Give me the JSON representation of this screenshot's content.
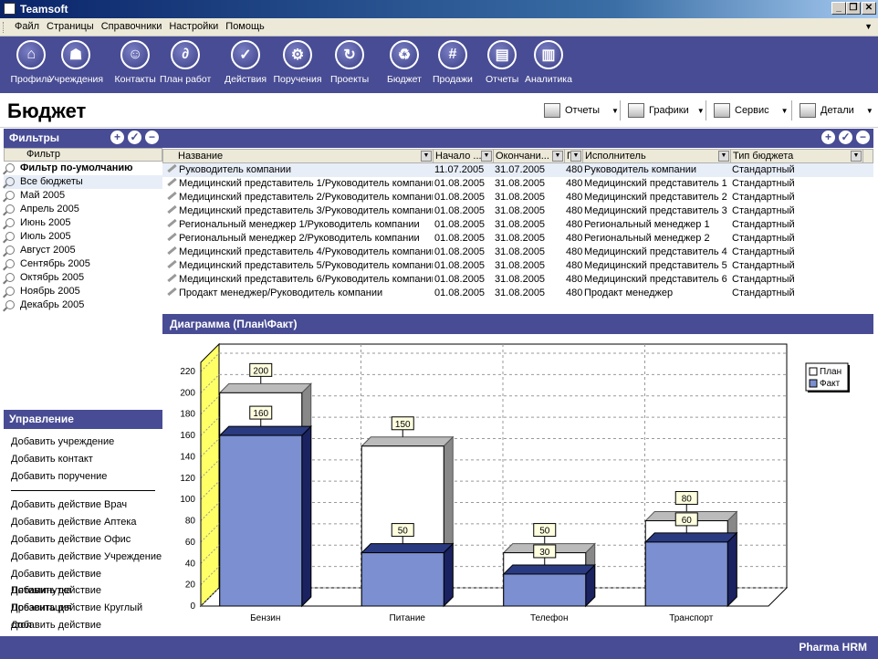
{
  "window": {
    "title": "Teamsoft"
  },
  "menu": [
    "Файл",
    "Страницы",
    "Справочники",
    "Настройки",
    "Помощь"
  ],
  "nav": [
    {
      "label": "Профиль",
      "icon": "house-icon",
      "glyph": "⌂"
    },
    {
      "label": "Учреждения",
      "icon": "people-icon",
      "glyph": "☗"
    },
    {
      "label": "Контакты",
      "icon": "person-icon",
      "glyph": "☺"
    },
    {
      "label": "План работ",
      "icon": "paperclip-icon",
      "glyph": "∂"
    },
    {
      "label": "Действия",
      "icon": "checkmark-icon",
      "glyph": "✓"
    },
    {
      "label": "Поручения",
      "icon": "gears-icon",
      "glyph": "⚙"
    },
    {
      "label": "Проекты",
      "icon": "arrow-icon",
      "glyph": "↻"
    },
    {
      "label": "Бюджет",
      "icon": "recycle-icon",
      "glyph": "♻"
    },
    {
      "label": "Продажи",
      "icon": "hash-icon",
      "glyph": "#"
    },
    {
      "label": "Отчеты",
      "icon": "document-icon",
      "glyph": "▤"
    },
    {
      "label": "Аналитика",
      "icon": "bar-chart-icon",
      "glyph": "▥"
    }
  ],
  "page": {
    "title": "Бюджет"
  },
  "toolbar": {
    "reports": "Отчеты",
    "charts": "Графики",
    "service": "Сервис",
    "details": "Детали"
  },
  "filters": {
    "title": "Фильтры",
    "column": "Фильтр",
    "items": [
      "Фильтр по-умолчанию",
      "Все бюджеты",
      "Май 2005",
      "Апрель 2005",
      "Июнь 2005",
      "Июль 2005",
      "Август 2005",
      "Сентябрь 2005",
      "Октябрь 2005",
      "Ноябрь 2005",
      "Декабрь 2005"
    ]
  },
  "management": {
    "title": "Управление",
    "group1": [
      "Добавить учреждение",
      "Добавить контакт",
      "Добавить поручение"
    ],
    "group2": [
      "Добавить действие Врач",
      "Добавить действие Аптека",
      "Добавить действие Офис",
      "Добавить действие Учреждение",
      "Добавить действие Пятиминутка",
      "Добавить действие Презентация",
      "Добавить действие Круглый стол",
      "Добавить действие Конференция"
    ]
  },
  "grid": {
    "columns": [
      "Название",
      "Начало ...",
      "Окончани...",
      "П...",
      "Исполнитель",
      "Тип бюджета"
    ],
    "rows": [
      [
        "Руководитель компании",
        "11.07.2005",
        "31.07.2005",
        "480",
        "Руководитель компании",
        "Стандартный"
      ],
      [
        "Медицинский представитель 1/Руководитель компании",
        "01.08.2005",
        "31.08.2005",
        "480",
        "Медицинский представитель 1",
        "Стандартный"
      ],
      [
        "Медицинский представитель 2/Руководитель компании",
        "01.08.2005",
        "31.08.2005",
        "480",
        "Медицинский представитель 2",
        "Стандартный"
      ],
      [
        "Медицинский представитель 3/Руководитель компании",
        "01.08.2005",
        "31.08.2005",
        "480",
        "Медицинский представитель 3",
        "Стандартный"
      ],
      [
        "Региональный менеджер 1/Руководитель компании",
        "01.08.2005",
        "31.08.2005",
        "480",
        "Региональный менеджер 1",
        "Стандартный"
      ],
      [
        "Региональный менеджер 2/Руководитель компании",
        "01.08.2005",
        "31.08.2005",
        "480",
        "Региональный менеджер 2",
        "Стандартный"
      ],
      [
        "Медицинский представитель 4/Руководитель компании",
        "01.08.2005",
        "31.08.2005",
        "480",
        "Медицинский представитель 4",
        "Стандартный"
      ],
      [
        "Медицинский представитель 5/Руководитель компании",
        "01.08.2005",
        "31.08.2005",
        "480",
        "Медицинский представитель 5",
        "Стандартный"
      ],
      [
        "Медицинский представитель 6/Руководитель компании",
        "01.08.2005",
        "31.08.2005",
        "480",
        "Медицинский представитель 6",
        "Стандартный"
      ],
      [
        "Продакт менеджер/Руководитель компании",
        "01.08.2005",
        "31.08.2005",
        "480",
        "Продакт менеджер",
        "Стандартный"
      ]
    ]
  },
  "chart_panel": {
    "title": "Диаграмма (План\\Факт)"
  },
  "chart_data": {
    "type": "bar",
    "title": "План/факт",
    "categories": [
      "Бензин",
      "Питание",
      "Телефон",
      "Транспорт"
    ],
    "series": [
      {
        "name": "План",
        "values": [
          200,
          150,
          50,
          80
        ],
        "color": "#ffffff"
      },
      {
        "name": "Факт",
        "values": [
          160,
          50,
          30,
          60
        ],
        "color": "#7b8fd1"
      }
    ],
    "ylim": [
      0,
      220
    ],
    "yticks": [
      0,
      20,
      40,
      60,
      80,
      100,
      120,
      140,
      160,
      180,
      200,
      220
    ],
    "grid": true,
    "legend": "top-right"
  },
  "status": {
    "brand": "Pharma HRM"
  },
  "colors": {
    "accent": "#484c94",
    "fact": "#7b8fd1",
    "wall": "#ffff66"
  }
}
